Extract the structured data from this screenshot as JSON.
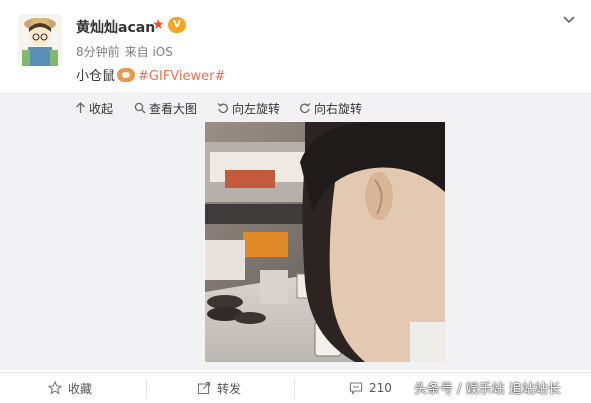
{
  "author": {
    "username": "黄灿灿acan",
    "badge_label": "V"
  },
  "meta": {
    "time": "8分钟前",
    "source": "来自 iOS"
  },
  "post": {
    "text": "小仓鼠",
    "emoji_icon": "hamster-emoji",
    "hashtag": "#GIFViewer#"
  },
  "media_toolbar": {
    "collapse": "收起",
    "view_full": "查看大图",
    "rotate_left": "向左旋转",
    "rotate_right": "向右旋转"
  },
  "actions": {
    "favorite": "收藏",
    "repost": "转发",
    "comment_count": "210"
  },
  "watermark": "头条号 / 娱乐站 追站站长",
  "colors": {
    "hashtag": "#eb7350",
    "star": "#f54a2a",
    "badge": "#f5a623",
    "media_background": "#f2f2f5"
  }
}
